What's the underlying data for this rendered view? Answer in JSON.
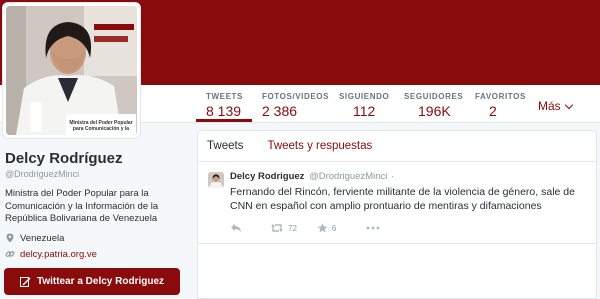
{
  "colors": {
    "brand": "#8a0b0b",
    "muted": "#8899a6",
    "text": "#292f33",
    "border": "#e1e8ed"
  },
  "profile": {
    "name": "Delcy Rodríguez",
    "handle": "@DrodriguezMinci",
    "bio": "Ministra del Poder Popular para la Comunicación y la Información de la República Bolivariana de Venezuela",
    "location": "Venezuela",
    "website": "delcy.patria.org.ve",
    "avatar_caption": "Ministra del Poder Popular para Comunicación y la Información"
  },
  "stats": [
    {
      "label": "TWEETS",
      "value": "8 139"
    },
    {
      "label": "FOTOS/VIDEOS",
      "value": "2 386"
    },
    {
      "label": "SIGUIENDO",
      "value": "112"
    },
    {
      "label": "SEGUIDORES",
      "value": "196K"
    },
    {
      "label": "FAVORITOS",
      "value": "2"
    }
  ],
  "more_label": "Más",
  "tweet_to_label": "Twittear a Delcy Rodriguez",
  "tabs": [
    {
      "label": "Tweets"
    },
    {
      "label": "Tweets y respuestas"
    }
  ],
  "tweet": {
    "name": "Delcy Rodriguez",
    "handle": "@DrodriguezMinci",
    "dot": "·",
    "text": "Fernando del Rincón, ferviente militante de la violencia de género, sale de CNN en español con amplio prontuario de mentiras y difamaciones",
    "retweets": "72",
    "favorites": "6"
  },
  "icons": {
    "location": "location-pin-icon",
    "link": "link-icon",
    "compose": "compose-icon",
    "reply": "reply-icon",
    "retweet": "retweet-icon",
    "favorite": "star-icon",
    "more": "more-dots-icon",
    "chevron": "chevron-down-icon"
  }
}
